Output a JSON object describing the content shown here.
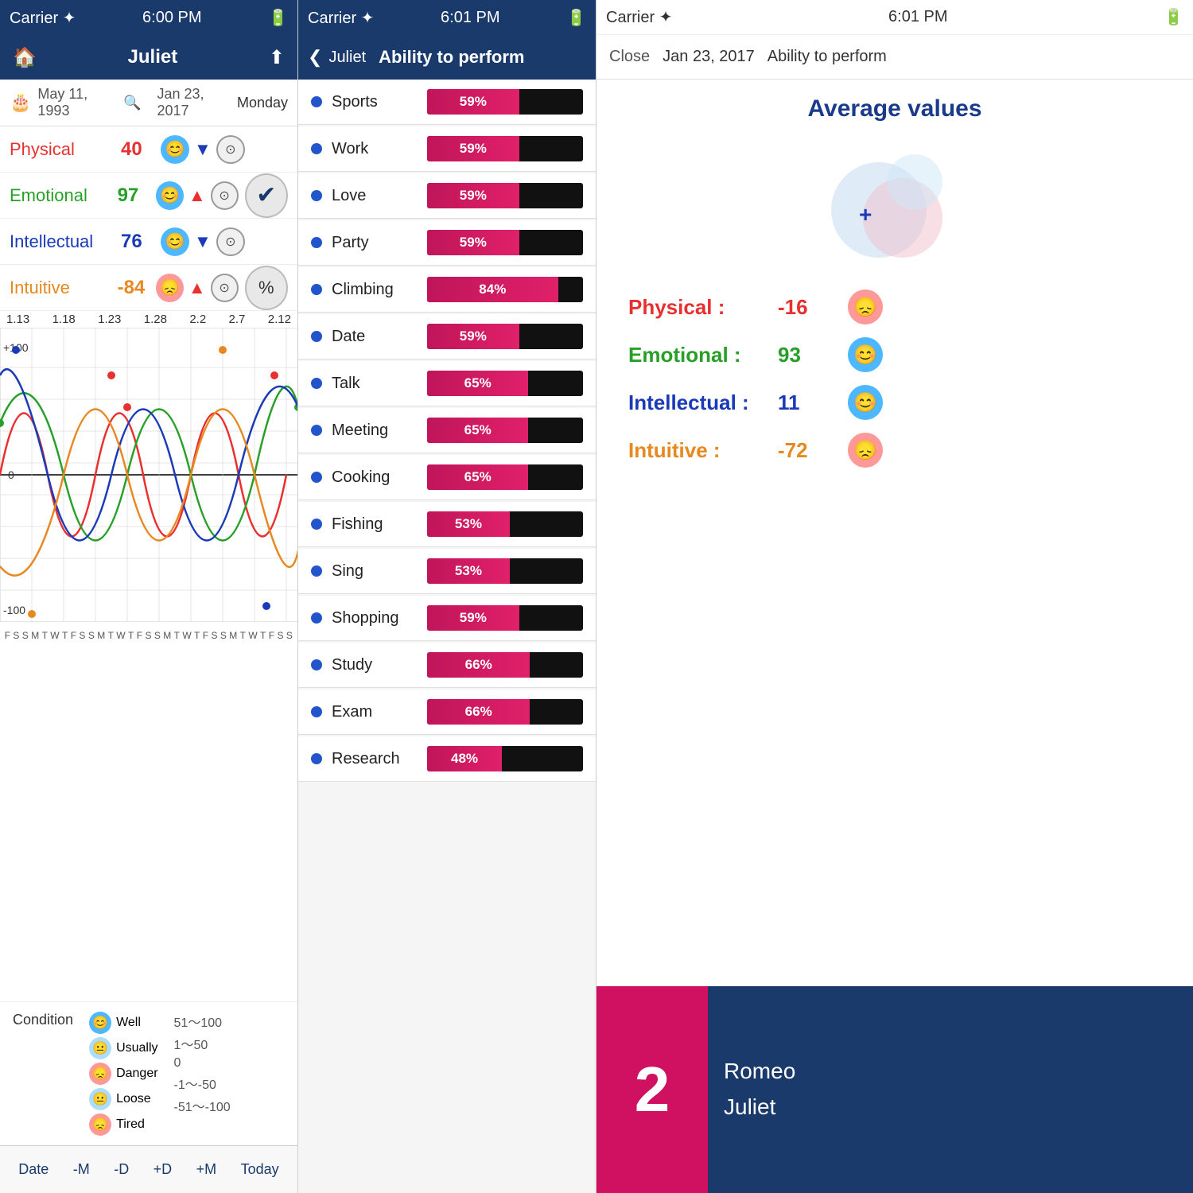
{
  "panel1": {
    "status_bar": {
      "carrier": "Carrier ✦",
      "time": "6:00 PM",
      "battery": "▮▮▮"
    },
    "nav_title": "Juliet",
    "birthday": "May 11, 1993",
    "current_date": "Jan 23, 2017",
    "day_name": "Monday",
    "bio_rows": [
      {
        "label": "Physical",
        "value": "40",
        "color": "physical",
        "emoji": "😊",
        "triangle": "▼",
        "triangle_color": "triangle-down"
      },
      {
        "label": "Emotional",
        "value": "97",
        "color": "emotional",
        "emoji": "😊",
        "triangle": "▲",
        "triangle_color": "triangle-up"
      },
      {
        "label": "Intellectual",
        "value": "76",
        "color": "intellectual",
        "emoji": "😊",
        "triangle": "▼",
        "triangle_color": "triangle-down"
      },
      {
        "label": "Intuitive",
        "value": "-84",
        "color": "intuitive",
        "emoji": "😞",
        "triangle": "▲",
        "triangle_color": "triangle-up"
      }
    ],
    "chart_x_labels": [
      "1.13",
      "1.18",
      "1.23",
      "1.28",
      "2.2",
      "2.7",
      "2.12"
    ],
    "chart_y_top": "+100",
    "chart_y_mid": "0",
    "chart_y_bot": "-100",
    "day_letters": [
      "F",
      "S",
      "S",
      "M",
      "T",
      "W",
      "T",
      "F",
      "S",
      "S",
      "M",
      "T",
      "W",
      "T",
      "F",
      "S",
      "S",
      "M",
      "T",
      "W",
      "T",
      "F",
      "S",
      "S",
      "M",
      "T",
      "W",
      "T",
      "F",
      "S",
      "S"
    ],
    "condition_title": "Condition",
    "conditions": [
      {
        "label": "Well",
        "range": "51～100",
        "mood": "happy"
      },
      {
        "label": "Usually",
        "range": "1～50",
        "mood": "happy"
      },
      {
        "label": "Danger",
        "range": "0",
        "mood": "sad"
      },
      {
        "label": "Loose",
        "range": "-1～-50",
        "mood": "neutral"
      },
      {
        "label": "Tired",
        "range": "-51～-100",
        "mood": "sad"
      }
    ],
    "toolbar": {
      "date": "Date",
      "minus_m": "-M",
      "minus_d": "-D",
      "plus_d": "+D",
      "plus_m": "+M",
      "today": "Today"
    }
  },
  "panel2": {
    "status_bar": {
      "carrier": "Carrier ✦",
      "time": "6:01 PM",
      "battery": "▮▮▮"
    },
    "nav_back_label": "Juliet",
    "nav_title": "Ability to perform",
    "items": [
      {
        "label": "Sports",
        "percent": 59,
        "pct_label": "59%"
      },
      {
        "label": "Work",
        "percent": 59,
        "pct_label": "59%"
      },
      {
        "label": "Love",
        "percent": 59,
        "pct_label": "59%"
      },
      {
        "label": "Party",
        "percent": 59,
        "pct_label": "59%"
      },
      {
        "label": "Climbing",
        "percent": 84,
        "pct_label": "84%"
      },
      {
        "label": "Date",
        "percent": 59,
        "pct_label": "59%"
      },
      {
        "label": "Talk",
        "percent": 65,
        "pct_label": "65%"
      },
      {
        "label": "Meeting",
        "percent": 65,
        "pct_label": "65%"
      },
      {
        "label": "Cooking",
        "percent": 65,
        "pct_label": "65%"
      },
      {
        "label": "Fishing",
        "percent": 53,
        "pct_label": "53%"
      },
      {
        "label": "Sing",
        "percent": 53,
        "pct_label": "53%"
      },
      {
        "label": "Shopping",
        "percent": 59,
        "pct_label": "59%"
      },
      {
        "label": "Study",
        "percent": 66,
        "pct_label": "66%"
      },
      {
        "label": "Exam",
        "percent": 66,
        "pct_label": "66%"
      },
      {
        "label": "Research",
        "percent": 48,
        "pct_label": "48%"
      }
    ]
  },
  "panel3": {
    "status_bar": {
      "carrier": "Carrier ✦",
      "time": "6:01 PM",
      "battery": "▮▮▮"
    },
    "nav_close": "Close",
    "nav_date": "Jan 23, 2017",
    "nav_title": "Ability to perform",
    "avg_title": "Average values",
    "avg_items": [
      {
        "label": "Physical :",
        "value": "-16",
        "color": "physical",
        "mood": "sad"
      },
      {
        "label": "Emotional :",
        "value": "93",
        "color": "emotional",
        "mood": "happy"
      },
      {
        "label": "Intellectual :",
        "value": "11",
        "color": "intellectual",
        "mood": "happy"
      },
      {
        "label": "Intuitive :",
        "value": "-72",
        "color": "intuitive",
        "mood": "sad"
      }
    ],
    "bottom_number": "2",
    "bottom_names": [
      "Romeo",
      "Juliet"
    ]
  }
}
